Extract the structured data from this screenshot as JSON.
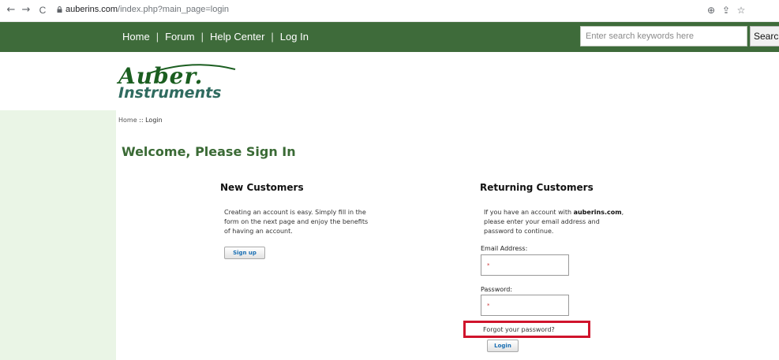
{
  "browser": {
    "url_host": "auberins.com",
    "url_path": "/index.php?main_page=login",
    "back_glyph": "←",
    "forward_glyph": "→",
    "reload_glyph": "C",
    "zoom_glyph": "⊕",
    "share_glyph": "⇪",
    "bookmark_glyph": "☆"
  },
  "nav": {
    "items": [
      {
        "label": "Home"
      },
      {
        "label": "Forum"
      },
      {
        "label": "Help Center"
      },
      {
        "label": "Log In"
      }
    ],
    "separator": "|",
    "search_placeholder": "Enter search keywords here",
    "search_button": "Search"
  },
  "logo": {
    "line1": "Auber.",
    "line2": "Instruments"
  },
  "breadcrumb": {
    "home": "Home",
    "sep": " :: ",
    "current": "Login"
  },
  "page_title": "Welcome, Please Sign In",
  "new_customers": {
    "title": "New Customers",
    "line1": "Creating an account is easy. Simply fill in the",
    "line2": "form on the next page and enjoy the benefits",
    "line3": "of having an account.",
    "button": "Sign up"
  },
  "returning_customers": {
    "title": "Returning Customers",
    "line1_pre": "If you have an account with ",
    "line1_bold": "auberins.com",
    "line1_post": ",",
    "line2": "please enter your email address and",
    "line3": "password to continue.",
    "email_label": "Email Address:",
    "password_label": "Password:",
    "required_mark": "*",
    "forgot_link": "Forgot your password?",
    "login_button": "Login"
  },
  "colors": {
    "nav_green": "#3e6b3a",
    "title_green": "#3a6a35",
    "highlight_red": "#d0142c",
    "left_column": "#eaf5e6"
  }
}
